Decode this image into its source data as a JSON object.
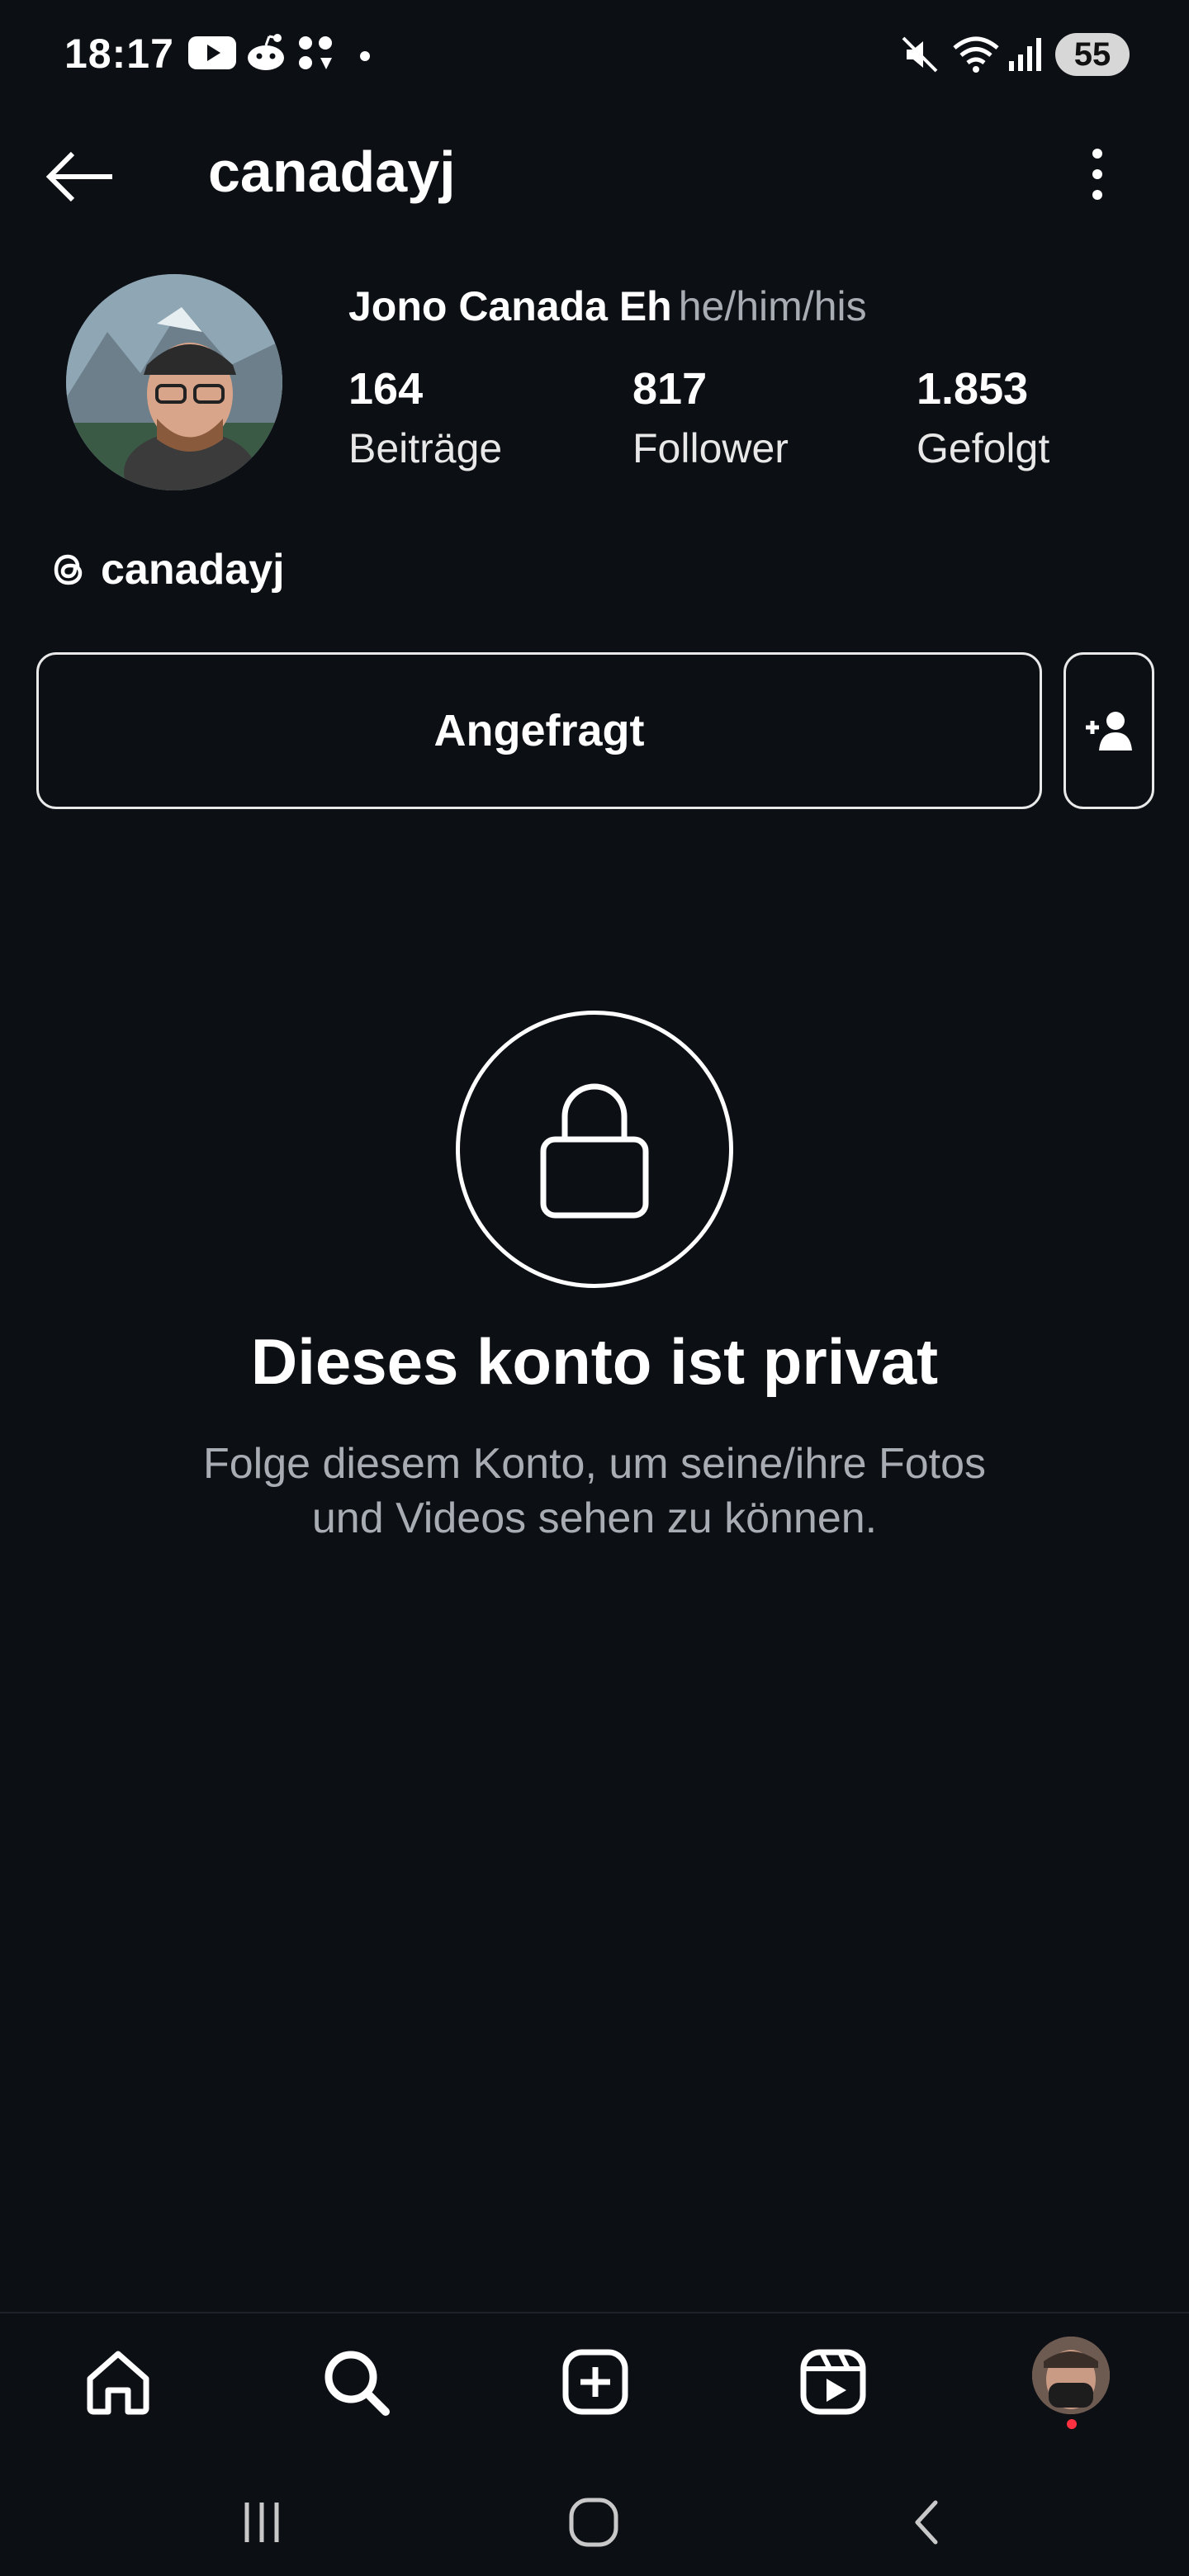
{
  "status_bar": {
    "time": "18:17",
    "battery": "55",
    "left_icons": [
      "youtube-icon",
      "reddit-icon",
      "app-icon",
      "dot-icon"
    ],
    "right_icons": [
      "mute-icon",
      "wifi-icon",
      "signal-icon"
    ]
  },
  "header": {
    "username": "canadayj",
    "back_icon": "arrow-left-icon",
    "menu_icon": "more-vertical-icon"
  },
  "profile": {
    "display_name": "Jono Canada Eh",
    "pronouns": "he/him/his",
    "stats": [
      {
        "count": "164",
        "label": "Beiträge"
      },
      {
        "count": "817",
        "label": "Follower"
      },
      {
        "count": "1.853",
        "label": "Gefolgt"
      }
    ],
    "threads_handle": "canadayj"
  },
  "actions": {
    "requested_label": "Angefragt",
    "suggest_icon": "add-person-icon"
  },
  "private_notice": {
    "title": "Dieses konto ist privat",
    "description": "Folge diesem Konto, um seine/ihre Fotos und Videos sehen zu können."
  },
  "bottom_nav": {
    "items": [
      "home-icon",
      "search-icon",
      "create-icon",
      "reels-icon",
      "profile-avatar"
    ]
  },
  "system_nav": {
    "items": [
      "recents-icon",
      "home-circle-icon",
      "back-chevron-icon"
    ]
  },
  "colors": {
    "background": "#0c0f14",
    "text_primary": "#ffffff",
    "text_secondary": "#a8adb4",
    "notification_dot": "#ff3040"
  }
}
